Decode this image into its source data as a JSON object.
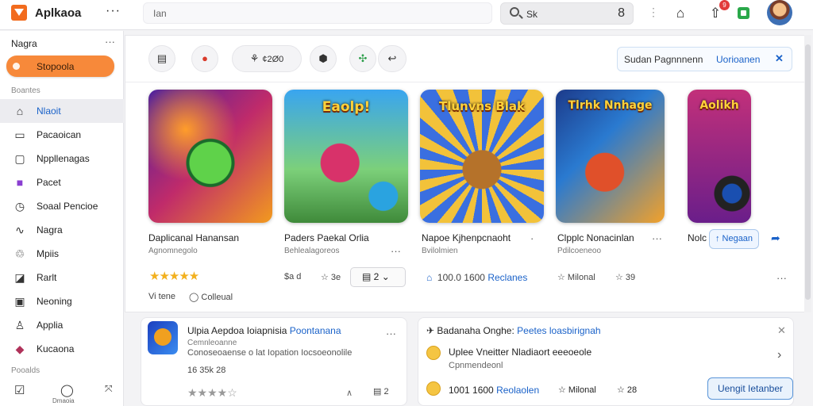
{
  "app": {
    "name": "Aplkaoa"
  },
  "search": {
    "left_text": "Ian",
    "query": "Sk",
    "count": "8"
  },
  "sidebar": {
    "header": "Nagra",
    "active": "Stopoola",
    "section1": "Boantes",
    "items": [
      {
        "label": "Nlaoit",
        "icon": "home-icon"
      },
      {
        "label": "Pacaoican",
        "icon": "card-icon"
      },
      {
        "label": "Nppllenagas",
        "icon": "frame-icon"
      },
      {
        "label": "Pacet",
        "icon": "puzzle-icon"
      },
      {
        "label": "Soaal Pencioe",
        "icon": "clock-icon"
      },
      {
        "label": "Nagra",
        "icon": "link-icon"
      },
      {
        "label": "Mpiis",
        "icon": "recycle-icon"
      },
      {
        "label": "Rarlt",
        "icon": "chart-icon"
      },
      {
        "label": "Neoning",
        "icon": "inbox-icon"
      },
      {
        "label": "Applia",
        "icon": "user-icon"
      },
      {
        "label": "Kucaona",
        "icon": "tag-icon"
      }
    ],
    "section2": "Pooalds",
    "bottom_label": "Dmaoia"
  },
  "filters": [
    {
      "icon": "document-icon",
      "text": ""
    },
    {
      "icon": "notification-icon",
      "text": ""
    },
    {
      "icon": "person-icon",
      "text": "¢2Ø0"
    },
    {
      "icon": "shield-icon",
      "text": ""
    },
    {
      "icon": "apps-icon",
      "text": ""
    },
    {
      "icon": "share-icon",
      "text": ""
    }
  ],
  "sort": {
    "label": "Sudan Pagnnnenn",
    "value": "Uorioanen"
  },
  "games": [
    {
      "title": "Daplicanal Hanansan",
      "subtitle": "Agnomnegolo",
      "art": "monster"
    },
    {
      "title": "Paders Paekal Orlia",
      "subtitle": "Behlealagoreos",
      "art": "Eaolp!",
      "rating_text": "3e"
    },
    {
      "title": "Napoe Kjhenpcnaoht",
      "subtitle": "Bvilolmien",
      "art": "Tlunvns Blak"
    },
    {
      "title": "Clpplc Nonacinlan",
      "subtitle": "Pdilcoeneoo",
      "art": "Tlrhk Nnhage"
    },
    {
      "title": "Nolc",
      "subtitle": "",
      "art": "Aolikh"
    }
  ],
  "row_meta": {
    "first_label": "Vi tene",
    "first_label2": "Colleual",
    "first_amount": "$a d",
    "rating_dropdown": "2",
    "downloads": "100.0 1600",
    "downloads_label": "Reclanes",
    "small_rating": "3",
    "mineral": "Milonal",
    "mineral2": "39"
  },
  "panel_left": {
    "title": "Ulpia Aepdoa Ioiapnisia",
    "link": "Poontanana",
    "sub1": "Cemnleoanne",
    "sub2": "Conoseoaense o lat Iopation Iocsoeonolile",
    "rating_text": "16 35k 28",
    "bottom": "2"
  },
  "panel_right": {
    "title": "Badanaha Onghe:",
    "link": "Peetes loasbirignah",
    "item_title": "Uplee Vneitter Nladiaort eeeoeole",
    "item_sub": "Cpnmendeonl",
    "downloads": "1001 1600",
    "downloads_label": "Reolaolen",
    "mineral": "Milonal",
    "mineral2": "28",
    "button": "Uengit Ietanber"
  }
}
